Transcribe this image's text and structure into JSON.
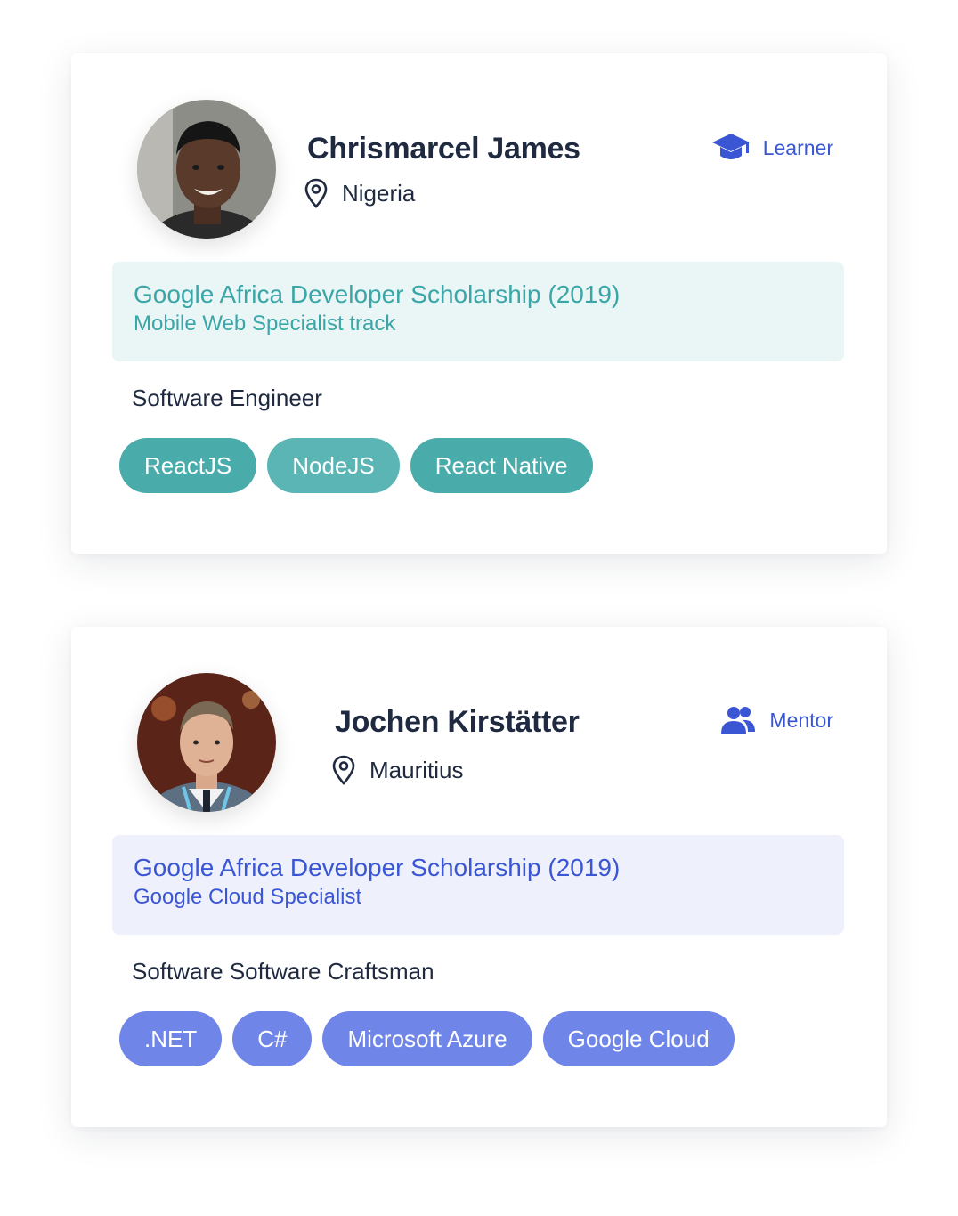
{
  "profiles": [
    {
      "name": "Chrismarcel James",
      "location": "Nigeria",
      "role": "Learner",
      "role_icon": "graduation-cap-icon",
      "program_title": "Google Africa Developer Scholarship (2019)",
      "program_track": "Mobile Web Specialist track",
      "job_title": "Software Engineer",
      "skills": [
        "ReactJS",
        "NodeJS",
        "React Native"
      ],
      "accent": "#3aa6a8"
    },
    {
      "name": "Jochen Kirstätter",
      "location": "Mauritius",
      "role": "Mentor",
      "role_icon": "people-icon",
      "program_title": "Google Africa Developer Scholarship (2019)",
      "program_track": "Google Cloud Specialist",
      "job_title": "Software Software Craftsman",
      "skills": [
        ".NET",
        "C#",
        "Microsoft Azure",
        "Google Cloud"
      ],
      "accent": "#3a56d4"
    }
  ]
}
